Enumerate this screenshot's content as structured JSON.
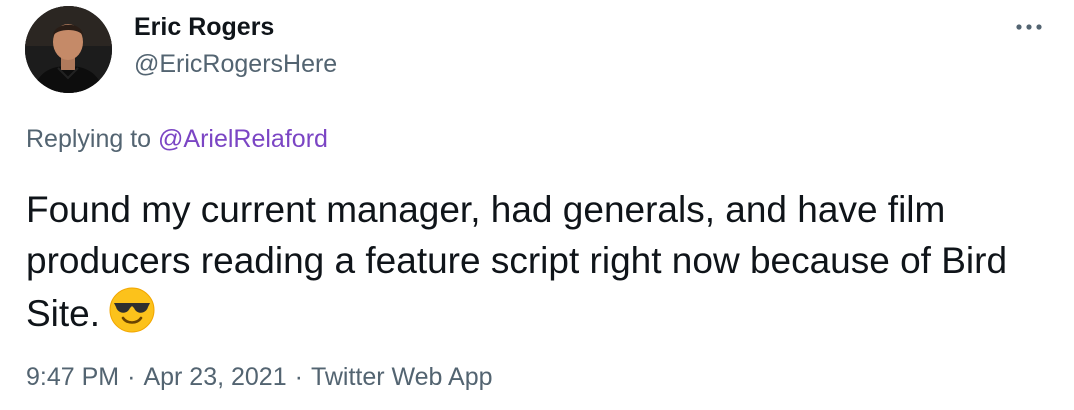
{
  "author": {
    "name": "Eric Rogers",
    "handle": "@EricRogersHere"
  },
  "reply": {
    "prefix": "Replying to ",
    "mention": "@ArielRelaford"
  },
  "tweet": {
    "text": "Found my current manager, had generals, and have film producers reading a feature script right now because of Bird Site.",
    "emoji": "smiling-face-with-sunglasses"
  },
  "meta": {
    "time": "9:47 PM",
    "separator": "·",
    "date": "Apr 23, 2021",
    "source": "Twitter Web App"
  },
  "icons": {
    "more": "more-horizontal-icon"
  },
  "colors": {
    "text": "#0f1419",
    "secondary": "#536471",
    "mention": "#7b45c4"
  }
}
